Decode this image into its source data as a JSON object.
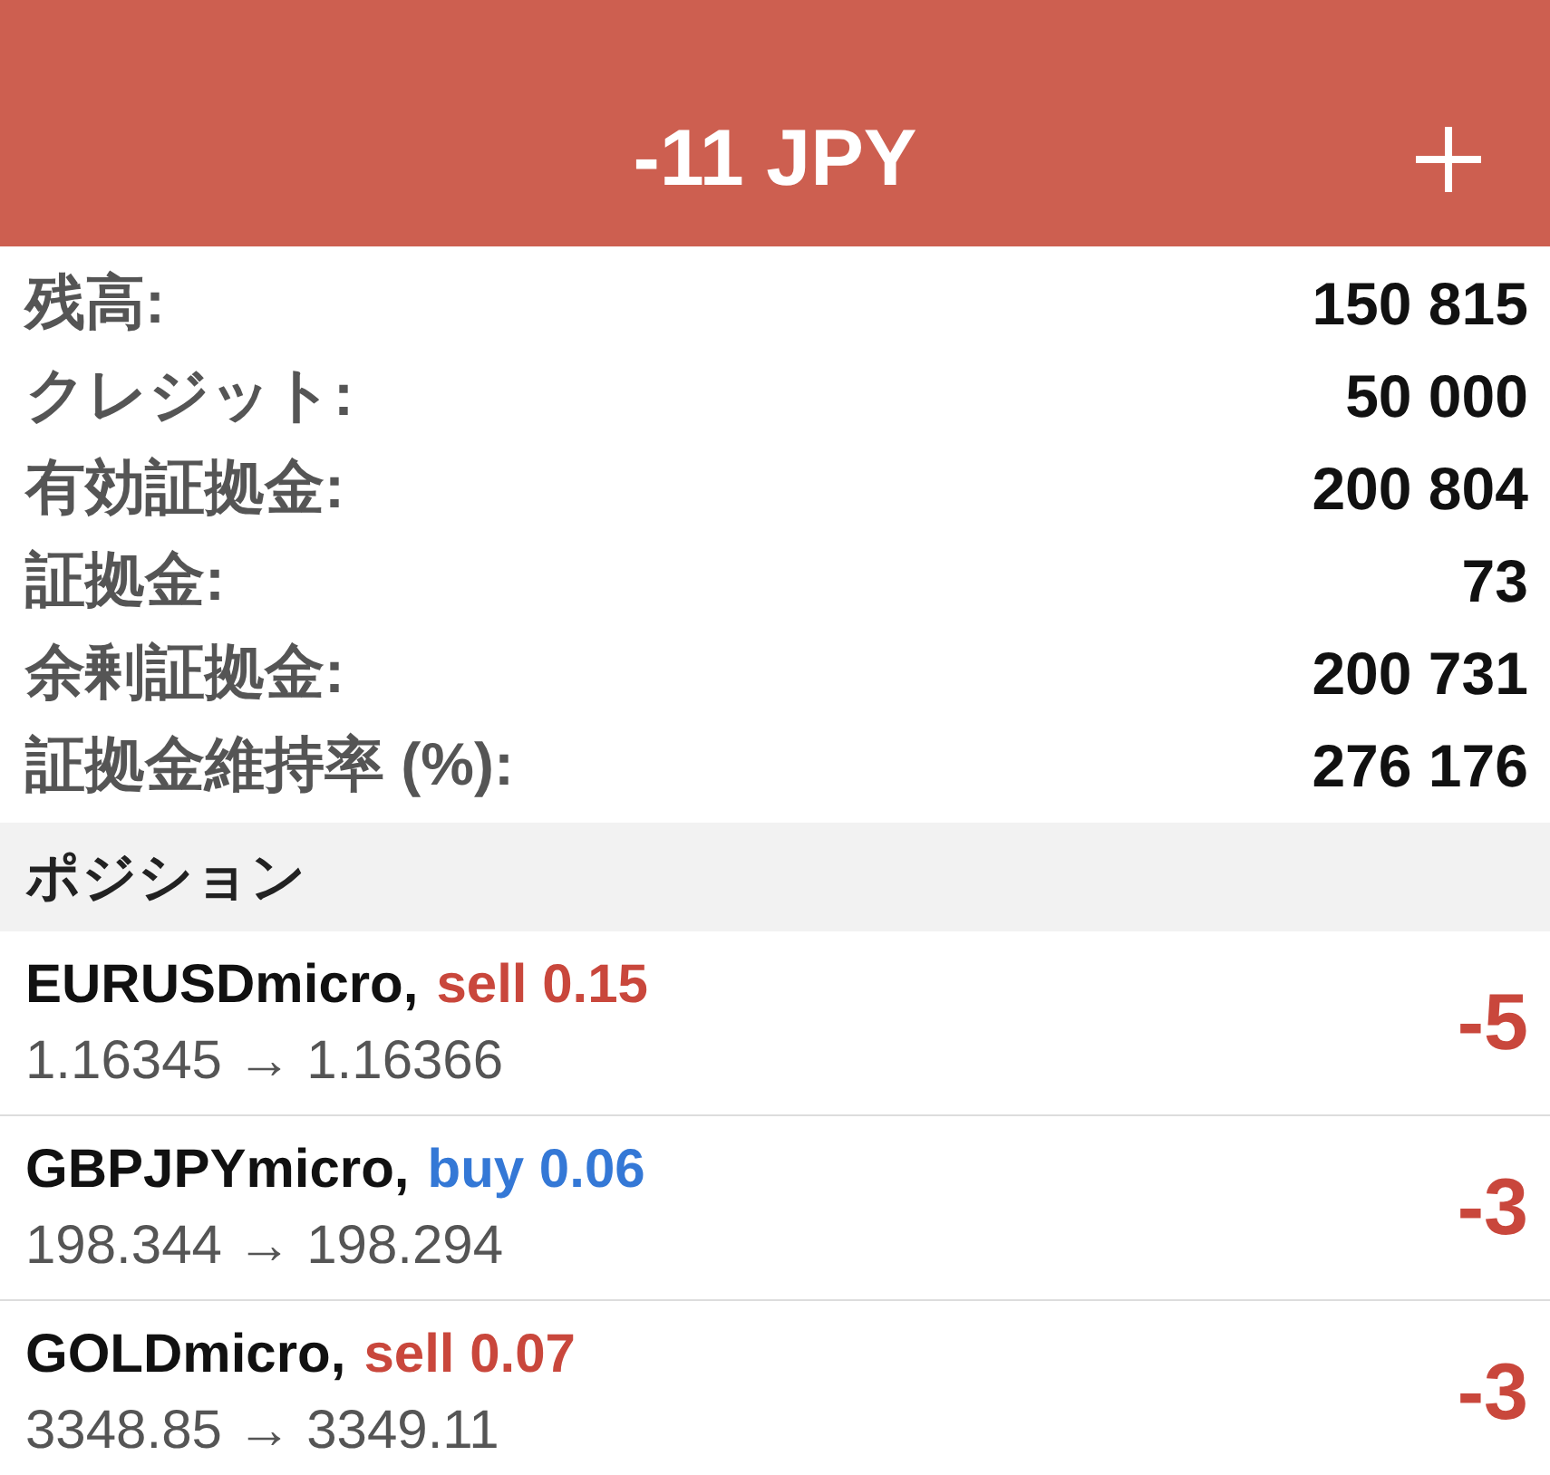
{
  "header": {
    "title": "-11 JPY"
  },
  "summary": [
    {
      "label": "残高:",
      "value": "150 815"
    },
    {
      "label": "クレジット:",
      "value": "50 000"
    },
    {
      "label": "有効証拠金:",
      "value": "200 804"
    },
    {
      "label": "証拠金:",
      "value": "73"
    },
    {
      "label": "余剰証拠金:",
      "value": "200 731"
    },
    {
      "label": "証拠金維持率 (%):",
      "value": "276 176"
    }
  ],
  "section": {
    "title": "ポジション"
  },
  "positions": [
    {
      "symbol": "EURUSDmicro,",
      "kind": "sell",
      "order": "sell 0.15",
      "prices": "1.16345 → 1.16366",
      "profit": "-5"
    },
    {
      "symbol": "GBPJPYmicro,",
      "kind": "buy",
      "order": "buy 0.06",
      "prices": "198.344 → 198.294",
      "profit": "-3"
    },
    {
      "symbol": "GOLDmicro,",
      "kind": "sell",
      "order": "sell 0.07",
      "prices": "3348.85 → 3349.11",
      "profit": "-3"
    }
  ]
}
